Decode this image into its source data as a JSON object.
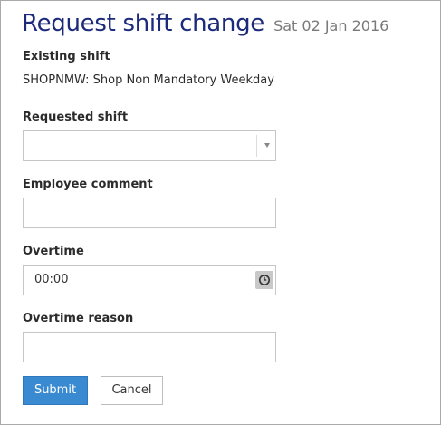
{
  "dialog": {
    "title": "Request shift change",
    "date": "Sat 02 Jan 2016"
  },
  "existing_shift": {
    "label": "Existing shift",
    "value": "SHOPNMW: Shop Non Mandatory Weekday"
  },
  "requested_shift": {
    "label": "Requested shift",
    "value": ""
  },
  "employee_comment": {
    "label": "Employee comment",
    "value": ""
  },
  "overtime": {
    "label": "Overtime",
    "value": "00:00",
    "icon": "clock-icon"
  },
  "overtime_reason": {
    "label": "Overtime reason",
    "value": ""
  },
  "actions": {
    "submit_label": "Submit",
    "cancel_label": "Cancel"
  },
  "colors": {
    "title": "#1b2a7a",
    "primary_button": "#3a8ad2"
  }
}
